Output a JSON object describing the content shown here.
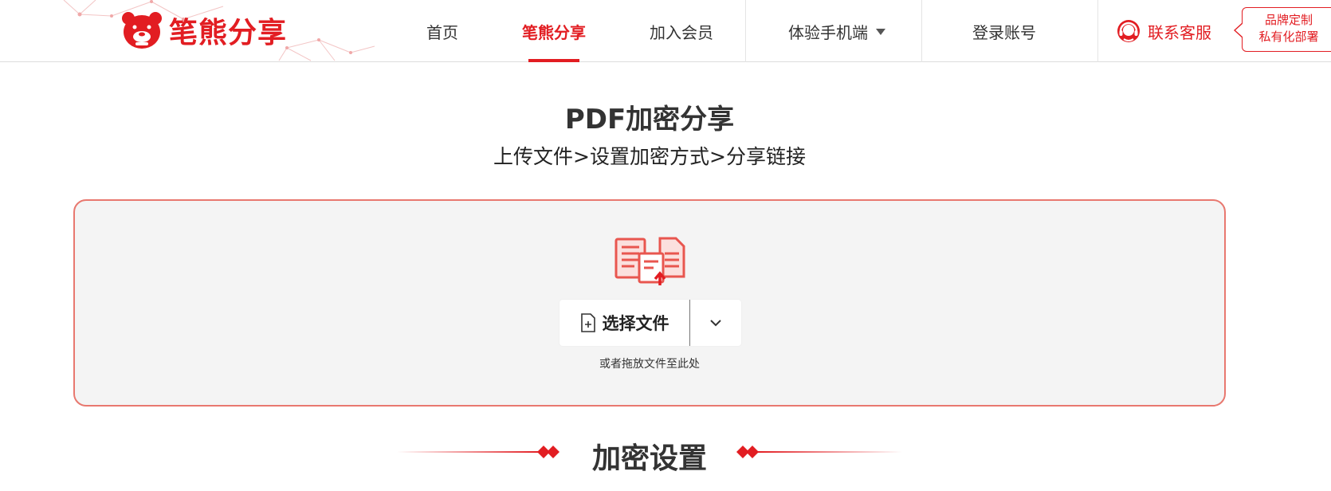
{
  "brand": {
    "name": "笔熊分享",
    "color": "#e21d22"
  },
  "nav": {
    "items": [
      {
        "label": "首页"
      },
      {
        "label": "笔熊分享",
        "active": true
      },
      {
        "label": "加入会员"
      },
      {
        "label": "体验手机端"
      },
      {
        "label": "登录账号"
      }
    ],
    "service_label": "联系客服",
    "custom": {
      "line1": "品牌定制",
      "line2": "私有化部署"
    }
  },
  "page": {
    "title": "PDF加密分享",
    "steps": "上传文件>设置加密方式>分享链接"
  },
  "upload": {
    "select_label": "选择文件",
    "drop_hint": "或者拖放文件至此处",
    "icon": "documents-upload-icon"
  },
  "section": {
    "title": "加密设置"
  },
  "colors": {
    "accent": "#e21d22",
    "upload_border": "#e8786f",
    "upload_bg": "#f4f4f4"
  }
}
